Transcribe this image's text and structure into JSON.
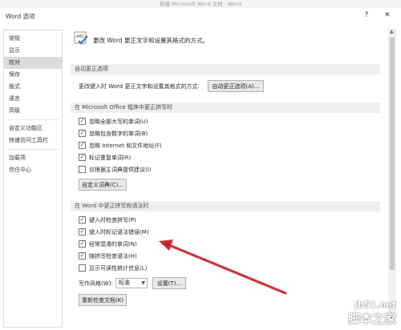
{
  "background_title": "新建 Microsoft Word 文档 - Word",
  "dialog": {
    "title": "Word 选项",
    "help": "?",
    "close": "✕"
  },
  "sidebar": {
    "items": [
      {
        "label": "常规",
        "active": false
      },
      {
        "label": "显示",
        "active": false
      },
      {
        "label": "校对",
        "active": true
      },
      {
        "label": "保存",
        "active": false
      },
      {
        "label": "版式",
        "active": false
      },
      {
        "label": "语言",
        "active": false
      },
      {
        "label": "高级",
        "active": false
      },
      {
        "label": "自定义功能区",
        "active": false
      },
      {
        "label": "快速访问工具栏",
        "active": false
      },
      {
        "label": "加载项",
        "active": false
      },
      {
        "label": "信任中心",
        "active": false
      }
    ]
  },
  "main": {
    "header_text": "更改 Word 更正文字和设置其格式的方式。",
    "autocorrect": {
      "section_title": "自动更正选项",
      "description": "更改键入时 Word 更正文字和设置其格式的方式:",
      "button": "自动更正选项(A)..."
    },
    "office": {
      "section_title": "在 Microsoft Office 程序中更正拼写时",
      "options": [
        {
          "label": "忽略全部大写的单词(U)",
          "checked": true
        },
        {
          "label": "忽略包含数字的单词(B)",
          "checked": true
        },
        {
          "label": "忽略 Internet 和文件地址(F)",
          "checked": true
        },
        {
          "label": "标记重复单词(R)",
          "checked": true
        },
        {
          "label": "仅根据主词典提供建议(I)",
          "checked": false
        }
      ],
      "button": "自定义词典(C)..."
    },
    "word": {
      "section_title": "在 Word 中更正拼写和语法时",
      "options": [
        {
          "label": "键入时检查拼写(P)",
          "checked": true
        },
        {
          "label": "键入时标记语法错误(M)",
          "checked": true
        },
        {
          "label": "经常混淆的单词(N)",
          "checked": true
        },
        {
          "label": "随拼写检查语法(H)",
          "checked": true
        },
        {
          "label": "显示可读性统计信息(L)",
          "checked": false
        }
      ],
      "style_label": "写作风格(W):",
      "style_value": "标准",
      "settings_button": "设置(T)...",
      "recheck_button": "重新检查文档(K)"
    }
  },
  "watermark": {
    "site": "jb51.net",
    "name": "脚本之家"
  },
  "colors": {
    "annotation_arrow": "#c0282c",
    "section_bg": "#efefef",
    "active_nav_bg": "#dcdcdc"
  }
}
